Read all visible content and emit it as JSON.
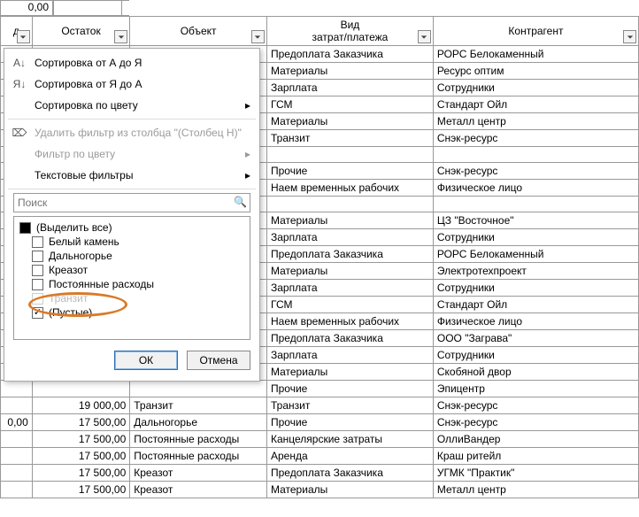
{
  "top_fragment": "0,00",
  "headers": {
    "col_d_suffix": "д",
    "ostatok": "Остаток",
    "object": "Объект",
    "type_line1": "Вид",
    "type_line2": "затрат/платежа",
    "contractor": "Контрагент"
  },
  "filter_menu": {
    "sort_asc": "Сортировка от А до Я",
    "sort_desc": "Сортировка от Я до А",
    "sort_color": "Сортировка по цвету",
    "clear_filter": "Удалить фильтр из столбца \"(Столбец H)\"",
    "filter_color": "Фильтр по цвету",
    "text_filters": "Текстовые фильтры",
    "search_placeholder": "Поиск",
    "checks": {
      "select_all": "(Выделить все)",
      "item1": "Белый камень",
      "item2": "Дальногорье",
      "item3": "Креазот",
      "item4": "Постоянные расходы",
      "item5": "Транзит",
      "item6": "(Пустые)"
    },
    "ok": "ОК",
    "cancel": "Отмена"
  },
  "rows": [
    {
      "type": "Предоплата Заказчика",
      "contractor": "РОРС Белокаменный"
    },
    {
      "type": "Материалы",
      "contractor": "Ресурс оптим"
    },
    {
      "type": "Зарплата",
      "contractor": "Сотрудники"
    },
    {
      "type": "ГСМ",
      "contractor": "Стандарт Ойл"
    },
    {
      "type": "Материалы",
      "contractor": "Металл центр"
    },
    {
      "type": "Транзит",
      "contractor": "Снэк-ресурс"
    },
    {
      "type": "",
      "contractor": ""
    },
    {
      "type": "Прочие",
      "contractor": "Снэк-ресурс"
    },
    {
      "type": "Наем временных рабочих",
      "contractor": "Физическое лицо"
    },
    {
      "type": "",
      "contractor": ""
    },
    {
      "type": "Материалы",
      "contractor": "ЦЗ \"Восточное\""
    },
    {
      "type": "Зарплата",
      "contractor": "Сотрудники"
    },
    {
      "type": "Предоплата Заказчика",
      "contractor": "РОРС Белокаменный"
    },
    {
      "type": "Материалы",
      "contractor": "Электротехпроект"
    },
    {
      "type": "Зарплата",
      "contractor": "Сотрудники"
    },
    {
      "type": "ГСМ",
      "contractor": "Стандарт Ойл"
    },
    {
      "type": "Наем временных рабочих",
      "contractor": "Физическое лицо"
    },
    {
      "type": "Предоплата Заказчика",
      "contractor": "ООО \"Заграва\""
    },
    {
      "type": "Зарплата",
      "contractor": "Сотрудники"
    },
    {
      "type": "Материалы",
      "contractor": "Скобяной двор"
    },
    {
      "type": "Прочие",
      "contractor": "Эпицентр"
    }
  ],
  "bottom_rows": [
    {
      "amount": "19 000,00",
      "object": "Транзит",
      "type": "Транзит",
      "contractor": "Снэк-ресурс"
    },
    {
      "prefix": "0,00",
      "amount": "17 500,00",
      "object": "Дальногорье",
      "type": "Прочие",
      "contractor": "Снэк-ресурс"
    },
    {
      "amount": "17 500,00",
      "object": "Постоянные расходы",
      "type": "Канцелярские затраты",
      "contractor": "ОллиВандер"
    },
    {
      "amount": "17 500,00",
      "object": "Постоянные расходы",
      "type": "Аренда",
      "contractor": "Краш ритейл"
    },
    {
      "amount": "17 500,00",
      "object": "Креазот",
      "type": "Предоплата Заказчика",
      "contractor": "УГМК \"Практик\""
    },
    {
      "amount": "17 500,00",
      "object": "Креазот",
      "type": "Материалы",
      "contractor": "Металл центр"
    }
  ]
}
